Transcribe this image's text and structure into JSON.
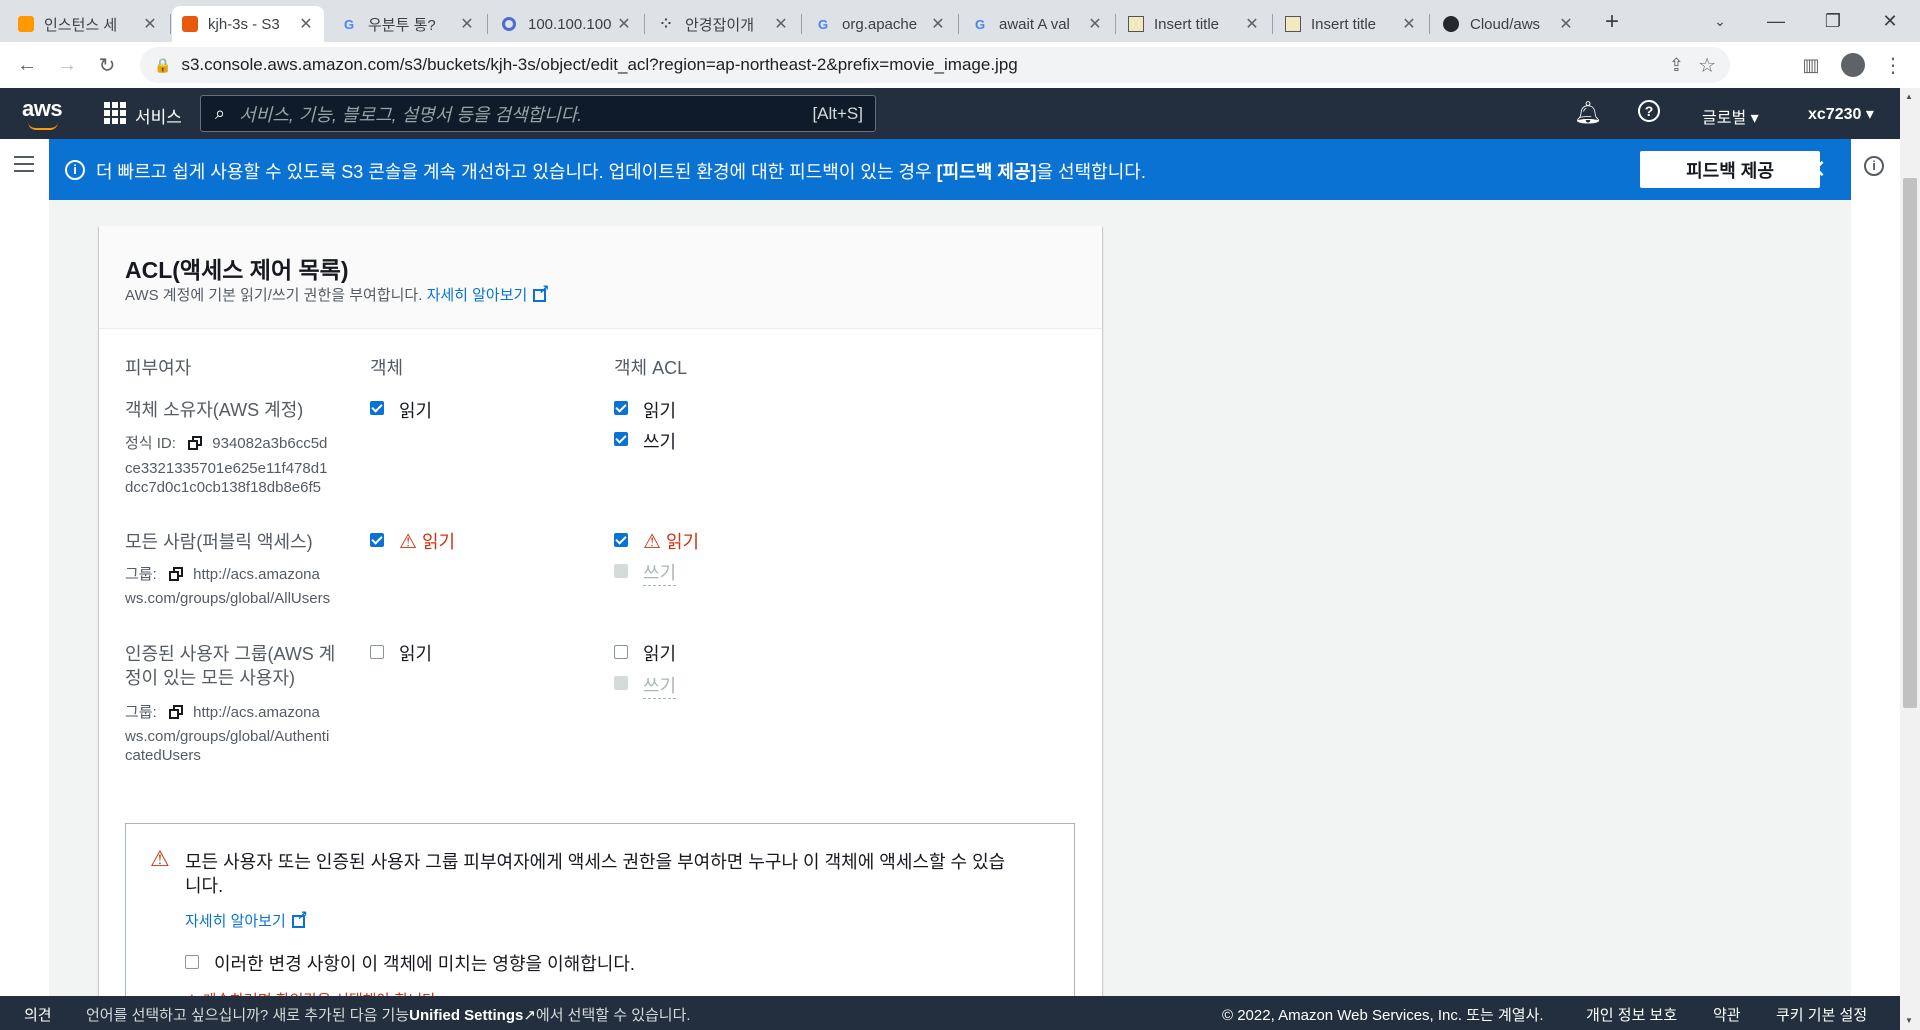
{
  "browser": {
    "tabs": [
      {
        "title": "인스턴스 세",
        "favicon": "aws-box-icon"
      },
      {
        "title": "kjh-3s - S3",
        "favicon": "s3-icon"
      },
      {
        "title": "우분투 통?",
        "favicon": "google-icon"
      },
      {
        "title": "100.100.100",
        "favicon": "globe-icon"
      },
      {
        "title": "안경잡이개",
        "favicon": "dots-icon"
      },
      {
        "title": "org.apache",
        "favicon": "google-icon"
      },
      {
        "title": "await A val",
        "favicon": "google-icon"
      },
      {
        "title": "Insert title",
        "favicon": "eclipse-icon"
      },
      {
        "title": "Insert title",
        "favicon": "eclipse-icon"
      },
      {
        "title": "Cloud/aws",
        "favicon": "github-icon"
      }
    ],
    "new_tab": "+",
    "url": "s3.console.aws.amazon.com/s3/buckets/kjh-3s/object/edit_acl?region=ap-northeast-2&prefix=movie_image.jpg"
  },
  "aws_header": {
    "logo": "aws",
    "services_label": "서비스",
    "search_placeholder": "서비스, 기능, 블로그, 설명서 등을 검색합니다.",
    "search_shortcut": "[Alt+S]",
    "region_label": "글로벌",
    "account_label": "xc7230"
  },
  "banner": {
    "text": "더 빠르고 쉽게 사용할 수 있도록 S3 콘솔을 계속 개선하고 있습니다. 업데이트된 환경에 대한 피드백이 있는 경우 ",
    "text_bold": "[피드백 제공]",
    "text_end": "을 선택합니다.",
    "button_label": "피드백 제공"
  },
  "acl": {
    "title": "ACL(액세스 제어 목록)",
    "description": "AWS 계정에 기본 읽기/쓰기 권한을 부여합니다.",
    "learn_more": "자세히 알아보기",
    "columns": [
      "피부여자",
      "객체",
      "객체 ACL"
    ],
    "owner": {
      "name": "객체 소유자(AWS 계정)",
      "id_label": "정식 ID:",
      "id_line1": "934082a3b6cc5d",
      "id_line2": "ce3321335701e625e11f478d1",
      "id_line3": "dcc7d0c1c0cb138f18db8e6f5",
      "object_read": "읽기",
      "acl_read": "읽기",
      "acl_write": "쓰기"
    },
    "everyone": {
      "name": "모든 사람(퍼블릭 액세스)",
      "group_label": "그룹:",
      "group_line1": "http://acs.amazona",
      "group_line2": "ws.com/groups/global/AllUsers",
      "object_read": "읽기",
      "acl_read": "읽기",
      "acl_write": "쓰기"
    },
    "authenticated": {
      "name_line1": "인증된 사용자 그룹(AWS 계",
      "name_line2": "정이 있는 모든 사용자)",
      "group_label": "그룹:",
      "group_line1": "http://acs.amazona",
      "group_line2": "ws.com/groups/global/Authenti",
      "group_line3": "catedUsers",
      "object_read": "읽기",
      "acl_read": "읽기",
      "acl_write": "쓰기"
    },
    "warning": {
      "line1": "모든 사용자 또는 인증된 사용자 그룹 피부여자에게 액세스 권한을 부여하면 누구나 이 객체에 액세스할 수 있습",
      "line2": "니다.",
      "learn_more": "자세히 알아보기",
      "confirm_label": "이러한 변경 사항이 이 객체에 미치는 영향을 이해합니다.",
      "error_text": "계속하려면 확인란을 선택해야 합니다."
    }
  },
  "footer": {
    "feedback": "의견",
    "lang_text_1": "언어를 선택하고 싶으십니까? 새로 추가된 다음 기능",
    "lang_bold": "Unified Settings",
    "lang_text_2": "에서 선택할 수 있습니다.",
    "copyright": "© 2022, Amazon Web Services, Inc. 또는 계열사.",
    "privacy": "개인 정보 보호",
    "terms": "약관",
    "cookies": "쿠키 기본 설정"
  },
  "colors": {
    "aws_nav": "#232f3e",
    "banner": "#0972d3",
    "checkbox": "#0972d3",
    "warning_red": "#d13212"
  }
}
